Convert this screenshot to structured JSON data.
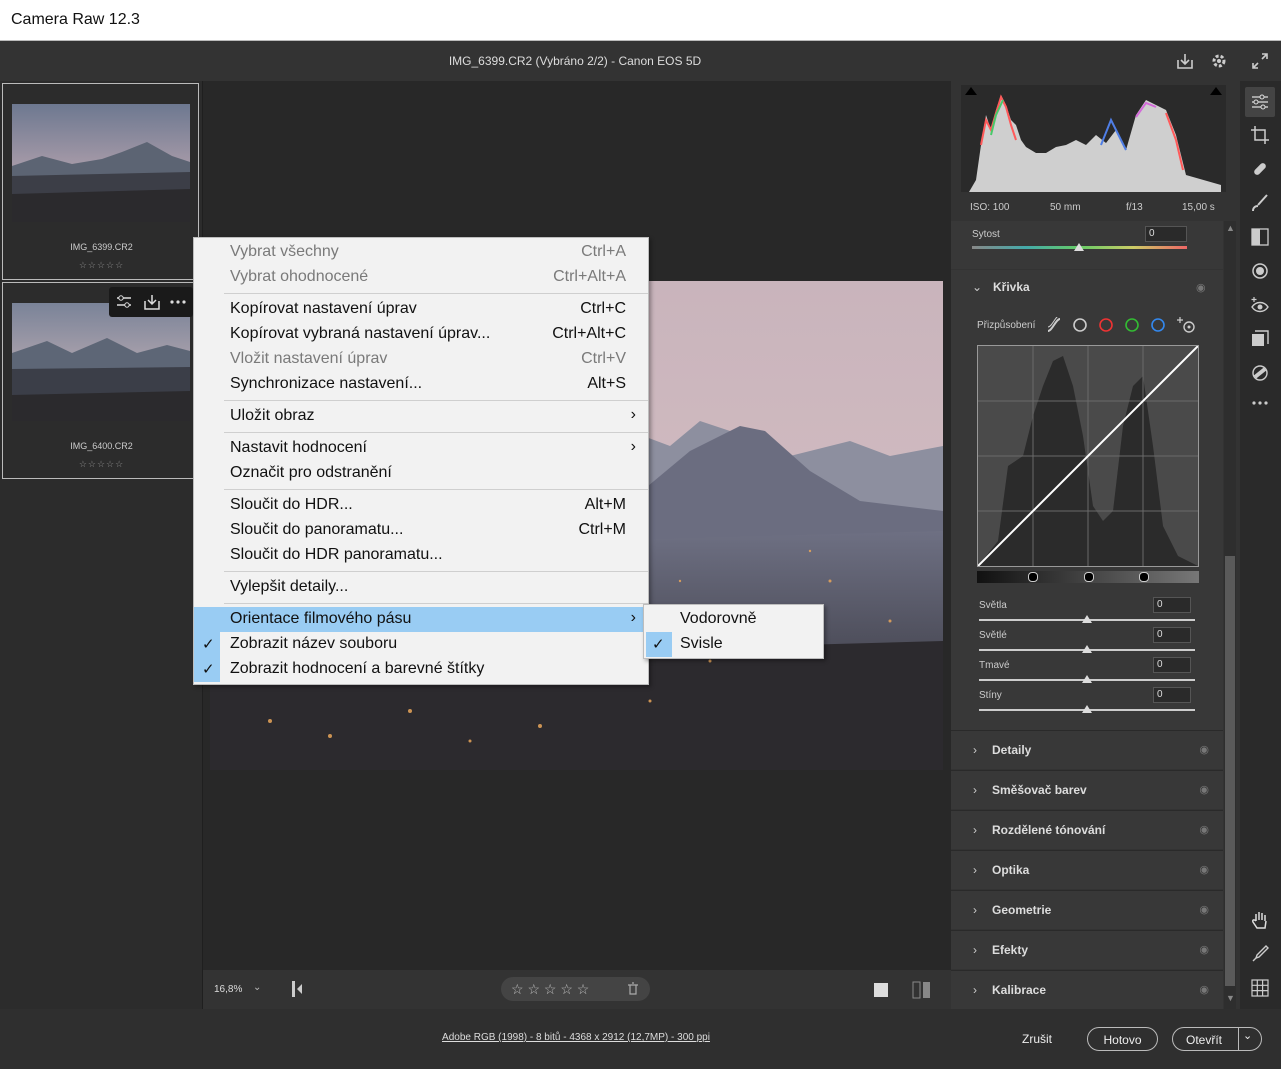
{
  "window": {
    "title": "Camera Raw 12.3"
  },
  "header": {
    "file_info": "IMG_6399.CR2 (Vybráno 2/2)  -  Canon EOS 5D"
  },
  "filmstrip": {
    "items": [
      {
        "name": "IMG_6399.CR2",
        "stars": "☆☆☆☆☆"
      },
      {
        "name": "IMG_6400.CR2",
        "stars": "☆☆☆☆☆"
      }
    ]
  },
  "context_menu": {
    "items": [
      {
        "label": "Vybrat všechny",
        "shortcut": "Ctrl+A"
      },
      {
        "label": "Vybrat ohodnocené",
        "shortcut": "Ctrl+Alt+A"
      },
      {
        "label": "Kopírovat nastavení úprav",
        "shortcut": "Ctrl+C"
      },
      {
        "label": "Kopírovat vybraná nastavení úprav...",
        "shortcut": "Ctrl+Alt+C"
      },
      {
        "label": "Vložit nastavení úprav",
        "shortcut": "Ctrl+V"
      },
      {
        "label": "Synchronizace nastavení...",
        "shortcut": "Alt+S"
      },
      {
        "label": "Uložit obraz",
        "shortcut": ""
      },
      {
        "label": "Nastavit hodnocení",
        "shortcut": ""
      },
      {
        "label": "Označit pro odstranění",
        "shortcut": ""
      },
      {
        "label": "Sloučit do HDR...",
        "shortcut": "Alt+M"
      },
      {
        "label": "Sloučit do panoramatu...",
        "shortcut": "Ctrl+M"
      },
      {
        "label": "Sloučit do HDR panoramatu...",
        "shortcut": ""
      },
      {
        "label": "Vylepšit detaily...",
        "shortcut": ""
      },
      {
        "label": "Orientace filmového pásu",
        "shortcut": ""
      },
      {
        "label": "Zobrazit název souboru",
        "shortcut": ""
      },
      {
        "label": "Zobrazit hodnocení a barevné štítky",
        "shortcut": ""
      }
    ],
    "submenu": [
      {
        "label": "Vodorovně"
      },
      {
        "label": "Svisle"
      }
    ]
  },
  "bottom_bar": {
    "zoom": "16,8%",
    "rating_stars": "☆ ☆ ☆ ☆ ☆"
  },
  "histogram_info": {
    "iso": "ISO: 100",
    "focal": "50 mm",
    "aperture": "f/13",
    "shutter": "15,00 s"
  },
  "panel": {
    "saturation_label": "Sytost",
    "saturation_value": "0",
    "curve": {
      "title": "Křivka",
      "adjust_label": "Přizpůsobení",
      "sliders": [
        {
          "label": "Světla",
          "value": "0"
        },
        {
          "label": "Světlé",
          "value": "0"
        },
        {
          "label": "Tmavé",
          "value": "0"
        },
        {
          "label": "Stíny",
          "value": "0"
        }
      ]
    },
    "sections": [
      "Detaily",
      "Směšovač barev",
      "Rozdělené tónování",
      "Optika",
      "Geometrie",
      "Efekty",
      "Kalibrace"
    ]
  },
  "footer": {
    "workflow_link": "Adobe RGB (1998) - 8 bitů - 4368 x 2912 (12,7MP) - 300 ppi",
    "cancel": "Zrušit",
    "done": "Hotovo",
    "open": "Otevřít"
  },
  "colors": {
    "menu_highlight": "#99ccf3",
    "panel_bg": "#333333",
    "canvas_bg": "#282828"
  }
}
